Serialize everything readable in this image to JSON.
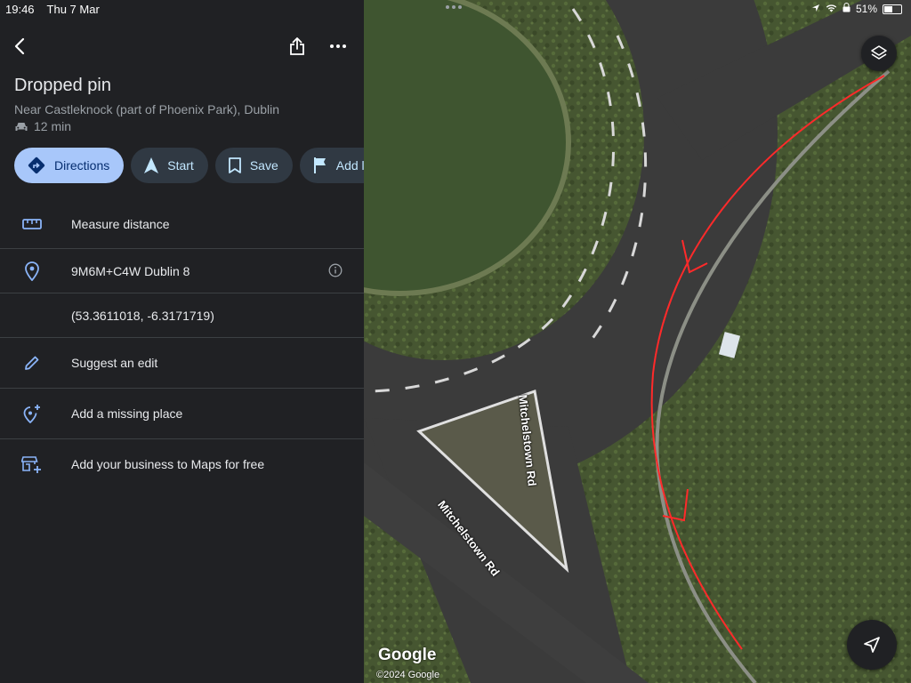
{
  "status": {
    "time": "19:46",
    "date": "Thu 7 Mar",
    "battery": "51%",
    "battery_level": 0.51
  },
  "place": {
    "title": "Dropped pin",
    "subtitle": "Near Castleknock (part of Phoenix Park), Dublin",
    "eta": "12 min"
  },
  "actions": [
    {
      "label": "Directions",
      "icon": "directions-icon"
    },
    {
      "label": "Start",
      "icon": "navigation-arrow-icon"
    },
    {
      "label": "Save",
      "icon": "bookmark-icon"
    },
    {
      "label": "Add label",
      "icon": "flag-icon"
    }
  ],
  "rows": {
    "measure": "Measure distance",
    "pluscode": "9M6M+C4W Dublin 8",
    "coords": "(53.3611018, -6.3171719)",
    "edit": "Suggest an edit",
    "missing": "Add a missing place",
    "business": "Add your business to Maps for free"
  },
  "map": {
    "road_label_1": "Mitchelstown Rd",
    "road_label_2": "Mitchelstown Rd",
    "logo": "Google",
    "copyright": "©2024 Google",
    "colors": {
      "grass": "#4a5a34",
      "road": "#3a3a3a",
      "annotation": "#ff2a2a"
    }
  }
}
